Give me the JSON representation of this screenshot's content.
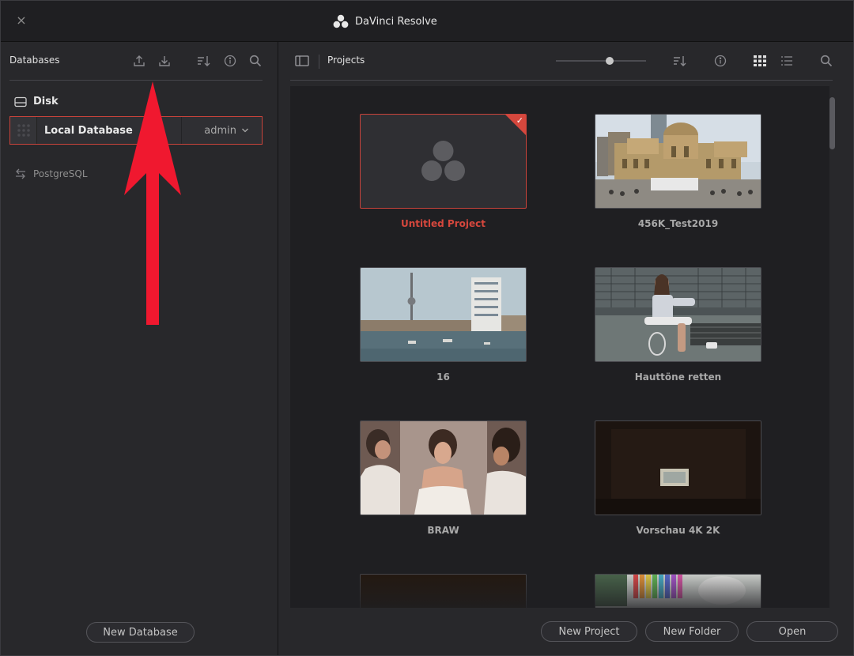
{
  "app": {
    "title": "DaVinci Resolve",
    "close_glyph": "×"
  },
  "databases": {
    "header": "Databases",
    "icons": [
      "upload-icon",
      "download-icon",
      "sort-icon",
      "info-icon",
      "search-icon"
    ],
    "disk_label": "Disk",
    "selected_db": {
      "name": "Local Database",
      "user": "admin"
    },
    "postgres_label": "PostgreSQL",
    "new_database_button": "New Database"
  },
  "projects": {
    "header": "Projects",
    "zoom_fraction": 0.6,
    "items": [
      {
        "label": "Untitled Project",
        "selected": true
      },
      {
        "label": "456K_Test2019",
        "selected": false
      },
      {
        "label": "16",
        "selected": false
      },
      {
        "label": "Hauttöne retten",
        "selected": false
      },
      {
        "label": "BRAW",
        "selected": false
      },
      {
        "label": "Vorschau 4K 2K",
        "selected": false
      }
    ],
    "buttons": {
      "new_project": "New Project",
      "new_folder": "New Folder",
      "open": "Open"
    }
  },
  "colors": {
    "accent": "#d5473d",
    "arrow": "#f0182f",
    "background": "#28282b"
  }
}
